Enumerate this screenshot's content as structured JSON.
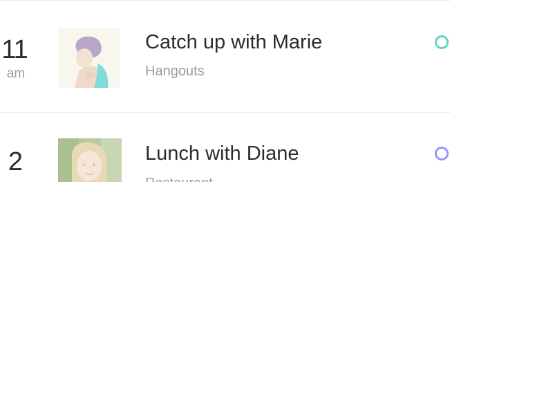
{
  "events": [
    {
      "time_hour": "11",
      "time_ampm": "am",
      "title": "Catch up with Marie",
      "subtitle": "Hangouts",
      "avatar_icon": "woman-with-ponytail-photo",
      "status_color": "#5fd6c5"
    },
    {
      "time_hour": "2",
      "time_ampm": "",
      "title": "Lunch with Diane",
      "subtitle": "Restaurant",
      "avatar_icon": "blonde-woman-photo",
      "status_color": "#9b94ff"
    }
  ],
  "colors": {
    "divider": "#e9e9ee",
    "text_primary": "#2c2c2f",
    "text_secondary": "#9a9a9f"
  }
}
